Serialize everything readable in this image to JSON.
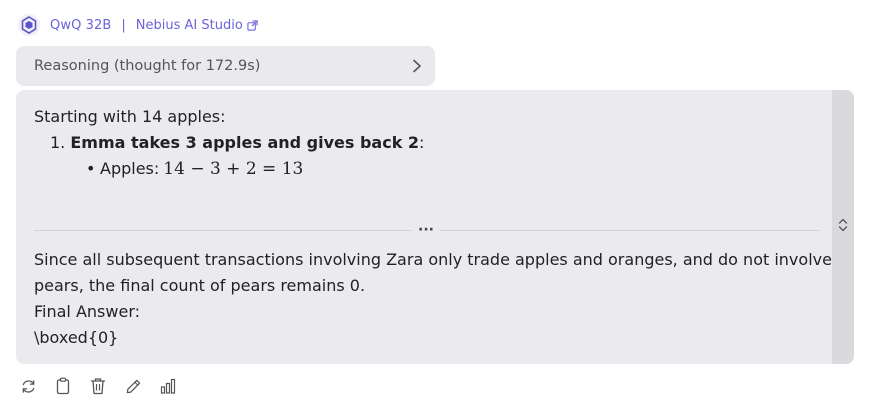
{
  "header": {
    "model_name": "QwQ 32B",
    "separator": "|",
    "provider": "Nebius AI Studio",
    "avatar_icon": "qwen-logo-icon",
    "external_icon": "external-link-icon",
    "accent_color": "#6c63d9"
  },
  "reasoning": {
    "label": "Reasoning (thought for 172.9s)",
    "icon": "chevron-right-icon"
  },
  "message": {
    "intro": "Starting with 14 apples:",
    "list_number": "1.",
    "list_item_bold": "Emma takes 3 apples and gives back 2",
    "list_item_colon": ":",
    "bullet_label": "Apples:",
    "bullet_math": "14 − 3 + 2 = 13",
    "more_label": "···",
    "answer_lines": [
      "Since all subsequent transactions involving Zara only trade apples and oranges, and do not involve",
      "pears, the final count of pears remains 0.",
      "Final Answer:",
      "\\boxed{0}"
    ]
  },
  "side_rail_icon": "expand-vertical-icon",
  "actions": [
    {
      "icon": "regenerate-icon"
    },
    {
      "icon": "copy-icon"
    },
    {
      "icon": "delete-icon"
    },
    {
      "icon": "edit-icon"
    },
    {
      "icon": "stats-icon"
    }
  ]
}
